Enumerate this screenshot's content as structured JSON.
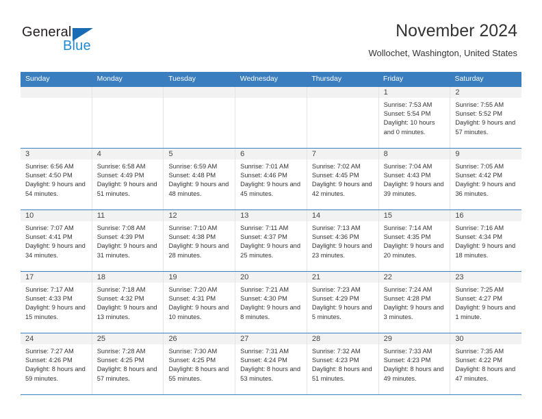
{
  "brand": {
    "name_top": "General",
    "name_bottom": "Blue",
    "triangle_color": "#1a6bb5",
    "blue_color": "#2089d4"
  },
  "header": {
    "title": "November 2024",
    "subtitle": "Wollochet, Washington, United States"
  },
  "theme": {
    "header_blue": "#3a7ebf",
    "daynum_strip": "#f2f2f2",
    "cell_border": "#e4e4e4"
  },
  "weekdays": [
    "Sunday",
    "Monday",
    "Tuesday",
    "Wednesday",
    "Thursday",
    "Friday",
    "Saturday"
  ],
  "weeks": [
    [
      {
        "day": "",
        "empty": true
      },
      {
        "day": "",
        "empty": true
      },
      {
        "day": "",
        "empty": true
      },
      {
        "day": "",
        "empty": true
      },
      {
        "day": "",
        "empty": true
      },
      {
        "day": "1",
        "sunrise": "Sunrise: 7:53 AM",
        "sunset": "Sunset: 5:54 PM",
        "daylight": "Daylight: 10 hours and 0 minutes."
      },
      {
        "day": "2",
        "sunrise": "Sunrise: 7:55 AM",
        "sunset": "Sunset: 5:52 PM",
        "daylight": "Daylight: 9 hours and 57 minutes."
      }
    ],
    [
      {
        "day": "3",
        "sunrise": "Sunrise: 6:56 AM",
        "sunset": "Sunset: 4:50 PM",
        "daylight": "Daylight: 9 hours and 54 minutes."
      },
      {
        "day": "4",
        "sunrise": "Sunrise: 6:58 AM",
        "sunset": "Sunset: 4:49 PM",
        "daylight": "Daylight: 9 hours and 51 minutes."
      },
      {
        "day": "5",
        "sunrise": "Sunrise: 6:59 AM",
        "sunset": "Sunset: 4:48 PM",
        "daylight": "Daylight: 9 hours and 48 minutes."
      },
      {
        "day": "6",
        "sunrise": "Sunrise: 7:01 AM",
        "sunset": "Sunset: 4:46 PM",
        "daylight": "Daylight: 9 hours and 45 minutes."
      },
      {
        "day": "7",
        "sunrise": "Sunrise: 7:02 AM",
        "sunset": "Sunset: 4:45 PM",
        "daylight": "Daylight: 9 hours and 42 minutes."
      },
      {
        "day": "8",
        "sunrise": "Sunrise: 7:04 AM",
        "sunset": "Sunset: 4:43 PM",
        "daylight": "Daylight: 9 hours and 39 minutes."
      },
      {
        "day": "9",
        "sunrise": "Sunrise: 7:05 AM",
        "sunset": "Sunset: 4:42 PM",
        "daylight": "Daylight: 9 hours and 36 minutes."
      }
    ],
    [
      {
        "day": "10",
        "sunrise": "Sunrise: 7:07 AM",
        "sunset": "Sunset: 4:41 PM",
        "daylight": "Daylight: 9 hours and 34 minutes."
      },
      {
        "day": "11",
        "sunrise": "Sunrise: 7:08 AM",
        "sunset": "Sunset: 4:39 PM",
        "daylight": "Daylight: 9 hours and 31 minutes."
      },
      {
        "day": "12",
        "sunrise": "Sunrise: 7:10 AM",
        "sunset": "Sunset: 4:38 PM",
        "daylight": "Daylight: 9 hours and 28 minutes."
      },
      {
        "day": "13",
        "sunrise": "Sunrise: 7:11 AM",
        "sunset": "Sunset: 4:37 PM",
        "daylight": "Daylight: 9 hours and 25 minutes."
      },
      {
        "day": "14",
        "sunrise": "Sunrise: 7:13 AM",
        "sunset": "Sunset: 4:36 PM",
        "daylight": "Daylight: 9 hours and 23 minutes."
      },
      {
        "day": "15",
        "sunrise": "Sunrise: 7:14 AM",
        "sunset": "Sunset: 4:35 PM",
        "daylight": "Daylight: 9 hours and 20 minutes."
      },
      {
        "day": "16",
        "sunrise": "Sunrise: 7:16 AM",
        "sunset": "Sunset: 4:34 PM",
        "daylight": "Daylight: 9 hours and 18 minutes."
      }
    ],
    [
      {
        "day": "17",
        "sunrise": "Sunrise: 7:17 AM",
        "sunset": "Sunset: 4:33 PM",
        "daylight": "Daylight: 9 hours and 15 minutes."
      },
      {
        "day": "18",
        "sunrise": "Sunrise: 7:18 AM",
        "sunset": "Sunset: 4:32 PM",
        "daylight": "Daylight: 9 hours and 13 minutes."
      },
      {
        "day": "19",
        "sunrise": "Sunrise: 7:20 AM",
        "sunset": "Sunset: 4:31 PM",
        "daylight": "Daylight: 9 hours and 10 minutes."
      },
      {
        "day": "20",
        "sunrise": "Sunrise: 7:21 AM",
        "sunset": "Sunset: 4:30 PM",
        "daylight": "Daylight: 9 hours and 8 minutes."
      },
      {
        "day": "21",
        "sunrise": "Sunrise: 7:23 AM",
        "sunset": "Sunset: 4:29 PM",
        "daylight": "Daylight: 9 hours and 5 minutes."
      },
      {
        "day": "22",
        "sunrise": "Sunrise: 7:24 AM",
        "sunset": "Sunset: 4:28 PM",
        "daylight": "Daylight: 9 hours and 3 minutes."
      },
      {
        "day": "23",
        "sunrise": "Sunrise: 7:25 AM",
        "sunset": "Sunset: 4:27 PM",
        "daylight": "Daylight: 9 hours and 1 minute."
      }
    ],
    [
      {
        "day": "24",
        "sunrise": "Sunrise: 7:27 AM",
        "sunset": "Sunset: 4:26 PM",
        "daylight": "Daylight: 8 hours and 59 minutes."
      },
      {
        "day": "25",
        "sunrise": "Sunrise: 7:28 AM",
        "sunset": "Sunset: 4:25 PM",
        "daylight": "Daylight: 8 hours and 57 minutes."
      },
      {
        "day": "26",
        "sunrise": "Sunrise: 7:30 AM",
        "sunset": "Sunset: 4:25 PM",
        "daylight": "Daylight: 8 hours and 55 minutes."
      },
      {
        "day": "27",
        "sunrise": "Sunrise: 7:31 AM",
        "sunset": "Sunset: 4:24 PM",
        "daylight": "Daylight: 8 hours and 53 minutes."
      },
      {
        "day": "28",
        "sunrise": "Sunrise: 7:32 AM",
        "sunset": "Sunset: 4:23 PM",
        "daylight": "Daylight: 8 hours and 51 minutes."
      },
      {
        "day": "29",
        "sunrise": "Sunrise: 7:33 AM",
        "sunset": "Sunset: 4:23 PM",
        "daylight": "Daylight: 8 hours and 49 minutes."
      },
      {
        "day": "30",
        "sunrise": "Sunrise: 7:35 AM",
        "sunset": "Sunset: 4:22 PM",
        "daylight": "Daylight: 8 hours and 47 minutes."
      }
    ]
  ]
}
